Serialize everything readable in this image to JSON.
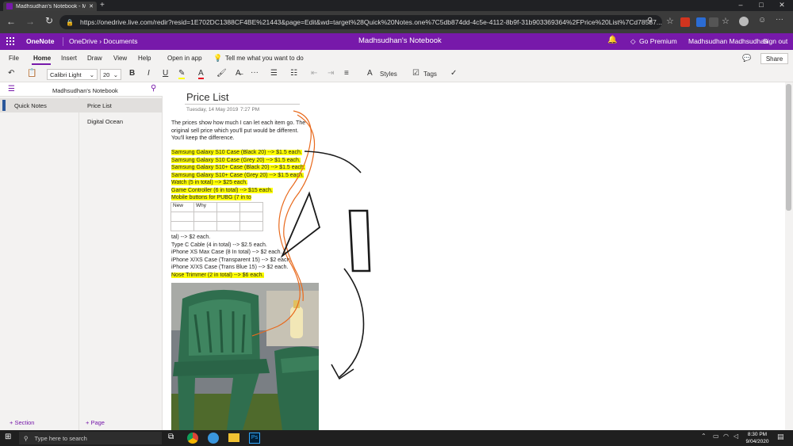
{
  "browser": {
    "tab_title": "Madhsudhan's Notebook - Micr",
    "new_tab": "+",
    "window_controls": [
      "–",
      "□",
      "✕"
    ],
    "url": "https://onedrive.live.com/redir?resid=1E702DC1388CF4BE%21443&page=Edit&wd=target%28Quick%20Notes.one%7C5db874dd-4c5e-4112-8b9f-31b903369364%2FPrice%20List%7Cd78587...",
    "url_host": "onedrive.live.com"
  },
  "onenote_header": {
    "app_name": "OneNote",
    "breadcrumb": "OneDrive › Documents",
    "notebook_title": "Madhsudhan's Notebook",
    "premium_label": "Go Premium",
    "user_name": "Madhsudhan Madhsudhan",
    "signout_label": "Sign out"
  },
  "menu": {
    "tabs": [
      "File",
      "Home",
      "Insert",
      "Draw",
      "View",
      "Help"
    ],
    "open_in_app": "Open in app",
    "tell_me": "Tell me what you want to do",
    "share": "Share"
  },
  "ribbon": {
    "font_name": "Calibri Light",
    "font_size": "20",
    "bold": "B",
    "italic": "I",
    "underline": "U",
    "more": "···",
    "styles": "Styles",
    "tags": "Tags"
  },
  "nav": {
    "notebook_name": "Madhsudhan's Notebook",
    "sections": [
      "Quick Notes"
    ],
    "pages": [
      "Price List",
      "Digital Ocean"
    ],
    "add_section": "+ Section",
    "add_page": "+ Page"
  },
  "page": {
    "title": "Price List",
    "date": "Tuesday, 14 May 2019",
    "time": "7:27 PM",
    "intro": [
      "The prices show how much I can let each item go. The",
      "original sell price which you'll put would be different.",
      "You'll keep the difference."
    ],
    "highlighted_items": [
      "Samsung Galaxy S10 Case (Black 20) --> $1.5 each.",
      "Samsung Galaxy S10 Case (Grey 20) --> $1.5 each.",
      "Samsung Galaxy S10+ Case (Black 20) --> $1.5 each.",
      "Samsung Galaxy S10+ Case (Grey 20) --> $1.5 each.",
      "Watch (5 in total) --> $25 each.",
      "Game Controller (6 in total) --> $15 each.",
      "Mobile buttons for PUBG (7 in to"
    ],
    "table": {
      "rows": [
        [
          "New",
          "Why",
          "",
          ""
        ],
        [
          "",
          "",
          "",
          ""
        ],
        [
          "",
          "",
          "",
          ""
        ]
      ]
    },
    "more_items": [
      "tal) --> $2 each.",
      "Type C Cable (4 in total) --> $2.5 each.",
      "iPhone XS Max Case (8  In total) --> $2 each.",
      "iPhone X/XS Case (Transparent 15) --> $2 each.",
      "iPhone X/XS Case (Trans Blue 15) --> $2 each."
    ],
    "last_highlighted": "Nose Trimmer (2 in total) --> $6 each."
  },
  "taskbar": {
    "search_placeholder": "Type here to search",
    "time": "8:30 PM",
    "date": "9/04/2020"
  },
  "colors": {
    "onenote_purple": "#7719aa",
    "highlight": "#ffff00",
    "ink_orange": "#e8691c",
    "ink_black": "#1a1a1a"
  }
}
